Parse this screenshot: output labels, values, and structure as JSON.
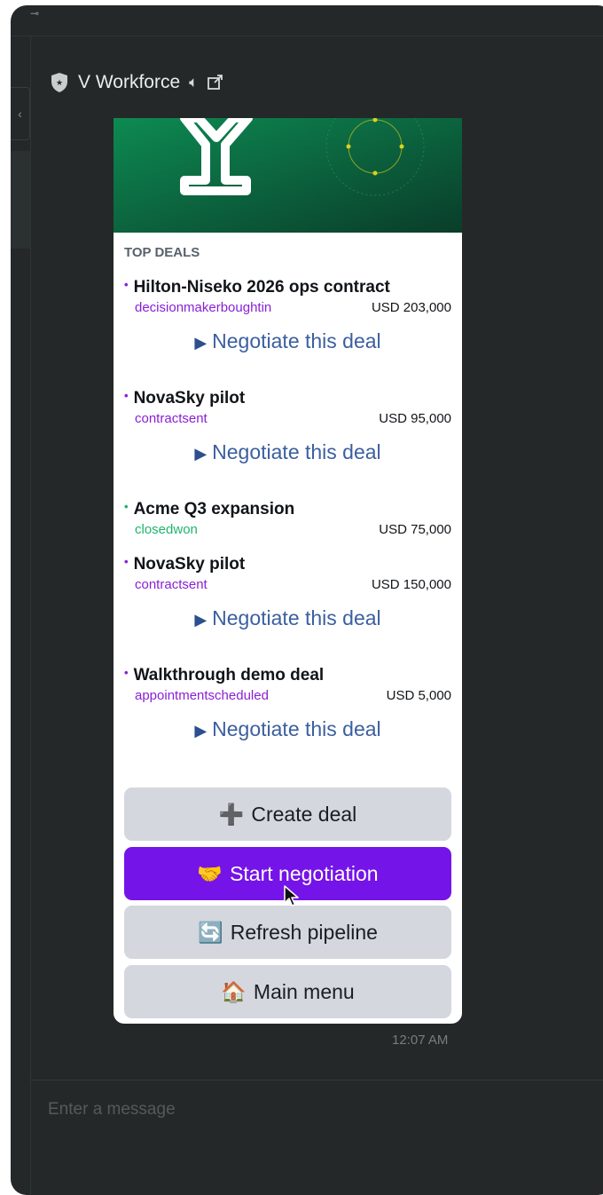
{
  "app": {
    "title": "V Workforce",
    "speaker_icon": "speaker-icon",
    "popout_icon": "external-link-icon",
    "rail_toggle": "‹"
  },
  "card": {
    "section_title": "TOP DEALS",
    "negotiate_label": "Negotiate this deal",
    "deals": [
      {
        "title": "Hilton-Niseko 2026 ops contract",
        "stage": "decisionmakerboughtin",
        "amount": "USD 203,000",
        "stage_color": "#8a1fd6",
        "has_negotiate": true
      },
      {
        "title": "NovaSky pilot",
        "stage": "contractsent",
        "amount": "USD 95,000",
        "stage_color": "#8a1fd6",
        "has_negotiate": true
      },
      {
        "title": "Acme Q3 expansion",
        "stage": "closedwon",
        "amount": "USD 75,000",
        "stage_color": "#1fb46a",
        "has_negotiate": false
      },
      {
        "title": "NovaSky pilot",
        "stage": "contractsent",
        "amount": "USD 150,000",
        "stage_color": "#8a1fd6",
        "has_negotiate": true
      },
      {
        "title": "Walkthrough demo deal",
        "stage": "appointmentscheduled",
        "amount": "USD 5,000",
        "stage_color": "#8a1fd6",
        "has_negotiate": true
      }
    ],
    "buttons": {
      "create": {
        "icon": "➕",
        "label": "Create deal"
      },
      "start": {
        "icon": "🤝",
        "label": "Start negotiation"
      },
      "refresh": {
        "icon": "🔄",
        "label": "Refresh pipeline"
      },
      "menu": {
        "icon": "🏠",
        "label": "Main menu"
      }
    }
  },
  "timestamp": "12:07 AM",
  "composer": {
    "placeholder": "Enter a message"
  },
  "colors": {
    "window_bg": "#242828",
    "accent_purple": "#7514e8",
    "banner_green": "#0f7a4a",
    "link_blue": "#3b5fa0"
  }
}
